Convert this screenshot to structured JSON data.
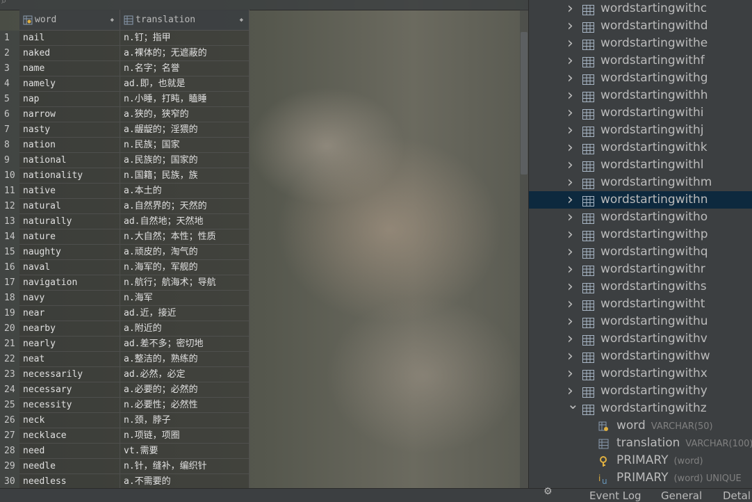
{
  "grid": {
    "columns": [
      {
        "name": "word",
        "icon": "key-column-icon"
      },
      {
        "name": "translation",
        "icon": "column-icon"
      }
    ],
    "rows": [
      {
        "n": "1",
        "word": "nail",
        "tr": "n.钉；指甲"
      },
      {
        "n": "2",
        "word": "naked",
        "tr": "a.裸体的；无遮蔽的"
      },
      {
        "n": "3",
        "word": "name",
        "tr": "n.名字；名誉"
      },
      {
        "n": "4",
        "word": "namely",
        "tr": "ad.即，也就是"
      },
      {
        "n": "5",
        "word": "nap",
        "tr": "n.小睡，打盹，瞌睡"
      },
      {
        "n": "6",
        "word": "narrow",
        "tr": "a.狭的，狭窄的"
      },
      {
        "n": "7",
        "word": "nasty",
        "tr": "a.龌龊的；淫猥的"
      },
      {
        "n": "8",
        "word": "nation",
        "tr": "n.民族；国家"
      },
      {
        "n": "9",
        "word": "national",
        "tr": "a.民族的；国家的"
      },
      {
        "n": "10",
        "word": "nationality",
        "tr": "n.国籍；民族，族"
      },
      {
        "n": "11",
        "word": "native",
        "tr": "a.本土的"
      },
      {
        "n": "12",
        "word": "natural",
        "tr": "a.自然界的；天然的"
      },
      {
        "n": "13",
        "word": "naturally",
        "tr": "ad.自然地；天然地"
      },
      {
        "n": "14",
        "word": "nature",
        "tr": "n.大自然；本性；性质"
      },
      {
        "n": "15",
        "word": "naughty",
        "tr": "a.顽皮的，淘气的"
      },
      {
        "n": "16",
        "word": "naval",
        "tr": "n.海军的，军舰的"
      },
      {
        "n": "17",
        "word": "navigation",
        "tr": "n.航行；航海术；导航"
      },
      {
        "n": "18",
        "word": "navy",
        "tr": "n.海军"
      },
      {
        "n": "19",
        "word": "near",
        "tr": "ad.近，接近"
      },
      {
        "n": "20",
        "word": "nearby",
        "tr": "a.附近的"
      },
      {
        "n": "21",
        "word": "nearly",
        "tr": "ad.差不多；密切地"
      },
      {
        "n": "22",
        "word": "neat",
        "tr": "a.整洁的，熟练的"
      },
      {
        "n": "23",
        "word": "necessarily",
        "tr": "ad.必然，必定"
      },
      {
        "n": "24",
        "word": "necessary",
        "tr": "a.必要的；必然的"
      },
      {
        "n": "25",
        "word": "necessity",
        "tr": "n.必要性；必然性"
      },
      {
        "n": "26",
        "word": "neck",
        "tr": "n.颈，脖子"
      },
      {
        "n": "27",
        "word": "necklace",
        "tr": "n.项链，项圈"
      },
      {
        "n": "28",
        "word": "need",
        "tr": "vt.需要"
      },
      {
        "n": "29",
        "word": "needle",
        "tr": "n.针，缝补，编织针"
      },
      {
        "n": "30",
        "word": "needless",
        "tr": "a.不需要的"
      }
    ]
  },
  "tree": {
    "tables": [
      "wordstartingwithc",
      "wordstartingwithd",
      "wordstartingwithe",
      "wordstartingwithf",
      "wordstartingwithg",
      "wordstartingwithh",
      "wordstartingwithi",
      "wordstartingwithj",
      "wordstartingwithk",
      "wordstartingwithl",
      "wordstartingwithm",
      "wordstartingwithn",
      "wordstartingwitho",
      "wordstartingwithp",
      "wordstartingwithq",
      "wordstartingwithr",
      "wordstartingwiths",
      "wordstartingwitht",
      "wordstartingwithu",
      "wordstartingwithv",
      "wordstartingwithw",
      "wordstartingwithx",
      "wordstartingwithy",
      "wordstartingwithz"
    ],
    "selected": "wordstartingwithn",
    "expanded": "wordstartingwithz",
    "children": [
      {
        "name": "word",
        "type": "VARCHAR(50)",
        "icon": "key-column-icon"
      },
      {
        "name": "translation",
        "type": "VARCHAR(100)",
        "icon": "column-icon"
      },
      {
        "name": "PRIMARY",
        "type": "(word)",
        "icon": "primary-key-icon"
      },
      {
        "name": "PRIMARY",
        "type": "(word) UNIQUE",
        "icon": "unique-index-icon"
      }
    ]
  },
  "bottom": {
    "tabs": [
      "Event Log",
      "General",
      "Detal"
    ]
  },
  "colors": {
    "panel": "#3c3f41",
    "selection": "#0d293e",
    "text": "#bbbbbb",
    "key": "#e0b040"
  }
}
